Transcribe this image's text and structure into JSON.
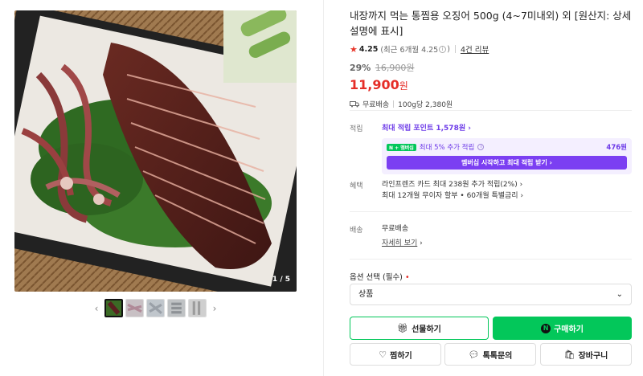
{
  "gallery": {
    "counter": "1 / 5",
    "prev_icon": "chevron-left-icon",
    "next_icon": "chevron-right-icon",
    "thumbnail_count": 5
  },
  "product": {
    "title": "내장까지 먹는 통찜용 오징어 500g (4~7미내외) 외 [원산지: 상세설명에 표시]",
    "rating": "4.25",
    "rating_detail": "(최근 6개월 4.25",
    "rating_close": ")",
    "review_link": "4건 리뷰",
    "discount": "29%",
    "original_price": "16,900원",
    "price": "11,900",
    "price_unit": "원",
    "shipping": "무료배송",
    "unit_price": "100g당 2,380원"
  },
  "points": {
    "label": "적립",
    "max_points": "최대 적립 포인트 1,578원",
    "badge": "N + 멤버십",
    "extra": "최대 5% 추가 적립",
    "extra_amount": "476원",
    "membership_button": "멤버십 시작하고 최대 적립 받기"
  },
  "benefits": {
    "label": "혜택",
    "line1": "라인프렌즈 카드 최대 238원 추가 적립(2%)",
    "line2": "최대 12개월 무이자 할부 • 60개월 특별금리"
  },
  "delivery": {
    "label": "배송",
    "value": "무료배송",
    "detail_link": "자세히 보기"
  },
  "options": {
    "label": "옵션 선택 (필수)",
    "required_mark": "•",
    "selected": "상품"
  },
  "actions": {
    "gift": "선물하기",
    "buy": "구매하기",
    "wish": "찜하기",
    "talk": "톡톡문의",
    "cart": "장바구니"
  },
  "colors": {
    "naver_green": "#03c75a",
    "price_red": "#e52d27",
    "points_purple": "#6d3be8"
  }
}
